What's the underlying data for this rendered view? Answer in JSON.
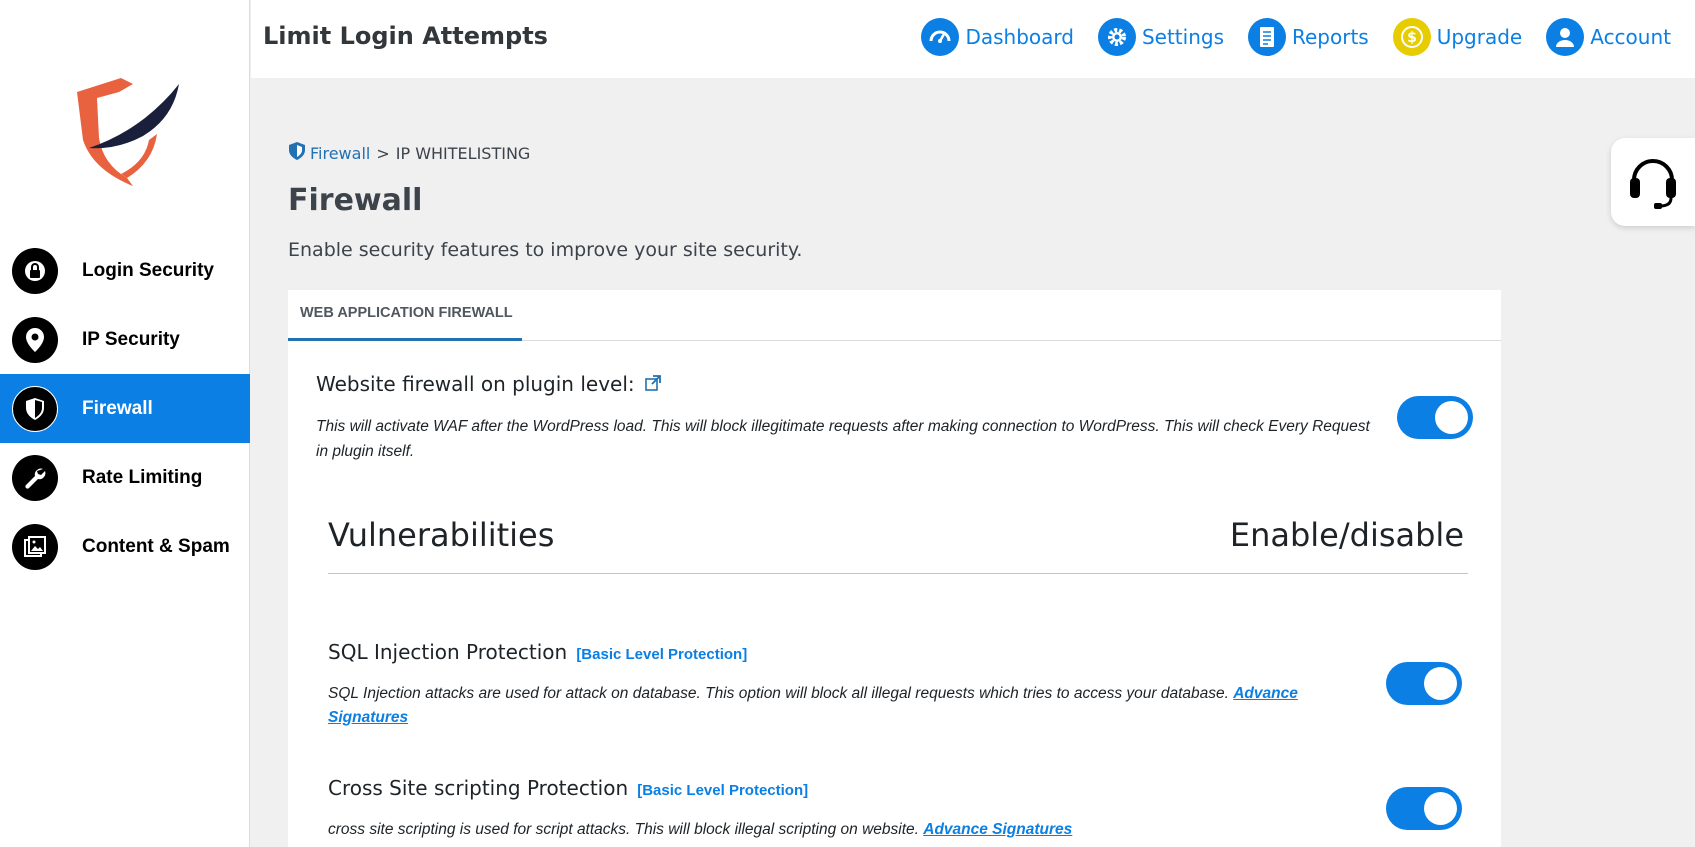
{
  "app": {
    "title": "Limit Login Attempts"
  },
  "topnav": [
    {
      "label": "Dashboard",
      "icon": "gauge-icon"
    },
    {
      "label": "Settings",
      "icon": "gear-icon"
    },
    {
      "label": "Reports",
      "icon": "document-icon"
    },
    {
      "label": "Upgrade",
      "icon": "dollar-icon"
    },
    {
      "label": "Account",
      "icon": "user-icon"
    }
  ],
  "sidebar": {
    "items": [
      {
        "label": "Login Security",
        "icon": "lock-icon",
        "active": false
      },
      {
        "label": "IP Security",
        "icon": "location-pin-icon",
        "active": false
      },
      {
        "label": "Firewall",
        "icon": "shield-icon",
        "active": true
      },
      {
        "label": "Rate Limiting",
        "icon": "wrench-icon",
        "active": false
      },
      {
        "label": "Content & Spam",
        "icon": "image-icon",
        "active": false
      }
    ]
  },
  "breadcrumb": {
    "parent": "Firewall",
    "separator": ">",
    "current": "IP WHITELISTING"
  },
  "page": {
    "title": "Firewall",
    "subtitle": "Enable security features to improve your site security."
  },
  "panel": {
    "tab": "WEB APPLICATION FIREWALL",
    "waf": {
      "title": "Website firewall on plugin level:",
      "description": "This will activate WAF after the WordPress load. This will block illegitimate requests after making connection to WordPress. This will check Every Request in plugin itself.",
      "enabled": true
    },
    "vulnerabilities_header": {
      "left": "Vulnerabilities",
      "right": "Enable/disable"
    },
    "features": [
      {
        "title": "SQL Injection Protection",
        "badge": "[Basic Level Protection]",
        "description": "SQL Injection attacks are used for attack on database. This option will block all illegal requests which tries to access your database.",
        "link": "Advance Signatures",
        "enabled": true
      },
      {
        "title": "Cross Site scripting Protection",
        "badge": "[Basic Level Protection]",
        "description": "cross site scripting is used for script attacks. This will block illegal scripting on website.",
        "link": "Advance Signatures",
        "enabled": true
      }
    ]
  },
  "colors": {
    "accent": "#0b7fe3",
    "upgrade": "#e6cc00",
    "logo_orange": "#e8623f",
    "logo_navy": "#1a1f3c"
  }
}
